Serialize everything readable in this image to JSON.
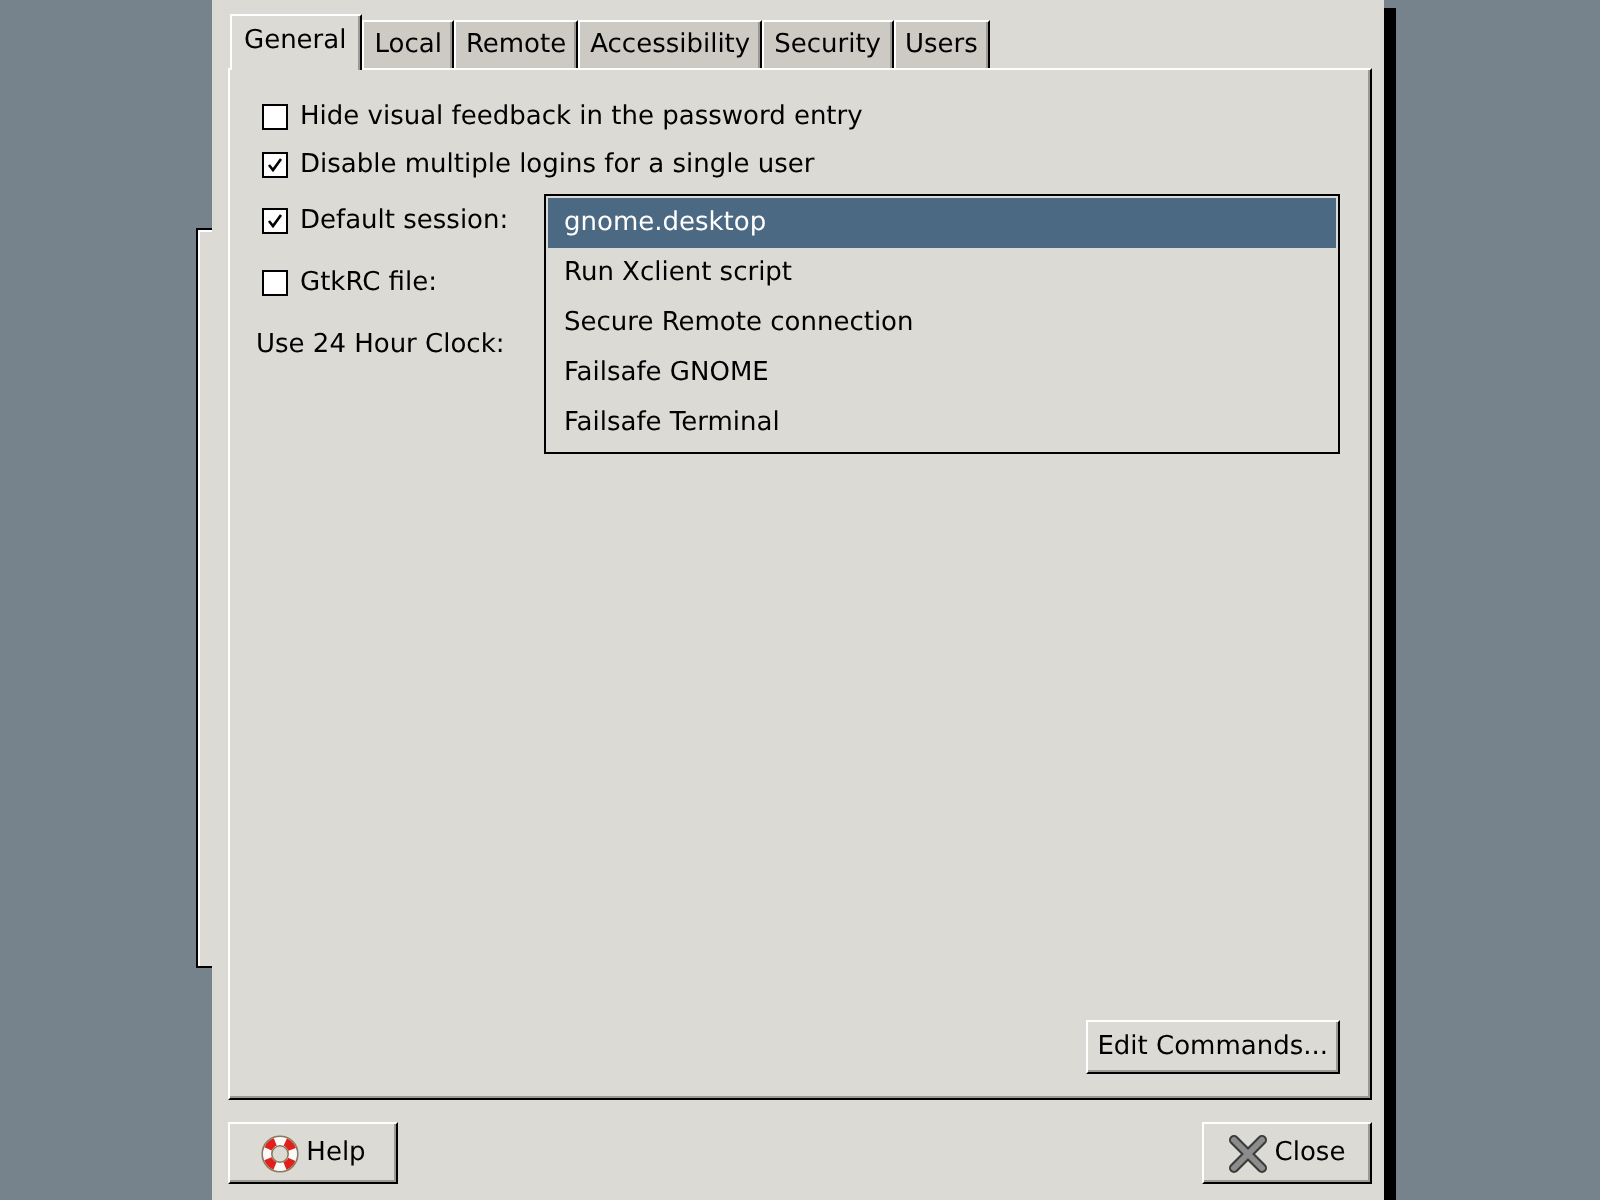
{
  "tabs": [
    {
      "label": "General",
      "selected": true
    },
    {
      "label": "Local",
      "selected": false
    },
    {
      "label": "Remote",
      "selected": false
    },
    {
      "label": "Accessibility",
      "selected": false
    },
    {
      "label": "Security",
      "selected": false
    },
    {
      "label": "Users",
      "selected": false
    }
  ],
  "options": [
    {
      "kind": "checkbox",
      "label": "Hide visual feedback in the password entry",
      "checked": false
    },
    {
      "kind": "checkbox",
      "label": "Disable multiple logins for a single user",
      "checked": true
    },
    {
      "kind": "checkbox",
      "label": "Default session:",
      "checked": true
    },
    {
      "kind": "checkbox",
      "label": "GtkRC file:",
      "checked": false
    },
    {
      "kind": "label",
      "label": "Use 24 Hour Clock:"
    }
  ],
  "session_list": {
    "items": [
      {
        "label": "gnome.desktop",
        "selected": true
      },
      {
        "label": "Run Xclient script",
        "selected": false
      },
      {
        "label": "Secure Remote connection",
        "selected": false
      },
      {
        "label": "Failsafe GNOME",
        "selected": false
      },
      {
        "label": "Failsafe Terminal",
        "selected": false
      }
    ]
  },
  "edit_commands_button": {
    "label": "Edit Commands..."
  },
  "buttons": [
    {
      "kind": "help",
      "label": "Help"
    },
    {
      "kind": "close",
      "label": "Close"
    }
  ]
}
